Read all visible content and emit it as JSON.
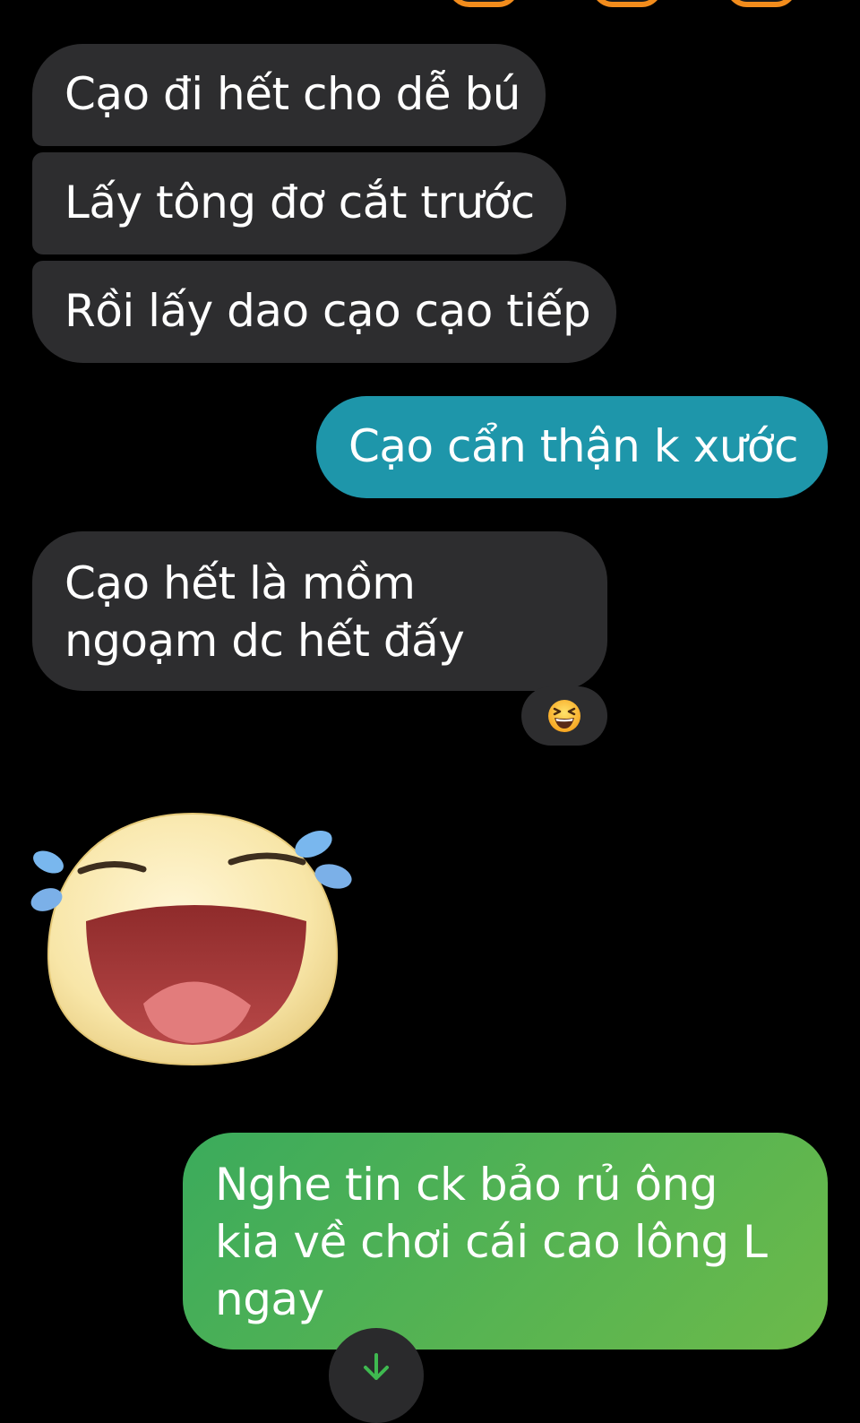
{
  "messages": [
    {
      "sender": "other",
      "text": "Cạo đi hết cho dễ bú"
    },
    {
      "sender": "other",
      "text": "Lấy tông đơ cắt trước"
    },
    {
      "sender": "other",
      "text": "Rồi lấy dao cạo cạo tiếp"
    },
    {
      "sender": "me",
      "text": "Cạo cẩn thận k xước"
    },
    {
      "sender": "other",
      "text": "Cạo hết là mồm ngoạm dc hết đấy",
      "reaction": "grinning-squinting-face"
    },
    {
      "sender": "other",
      "sticker": "laughing-tears-face-sticker"
    },
    {
      "sender": "me",
      "text": "Nghe tin ck bảo rủ ông kia về chơi cái cao lông L ngay"
    }
  ],
  "colors": {
    "background": "#000000",
    "incoming_bubble": "#2d2d2f",
    "outgoing_teal": "#1e96aa",
    "outgoing_green": "#3bab5c",
    "avatar_ring": "#f28c1c"
  },
  "icons": {
    "reaction": "grinning-squinting-face-icon",
    "scroll": "arrow-down-icon"
  }
}
